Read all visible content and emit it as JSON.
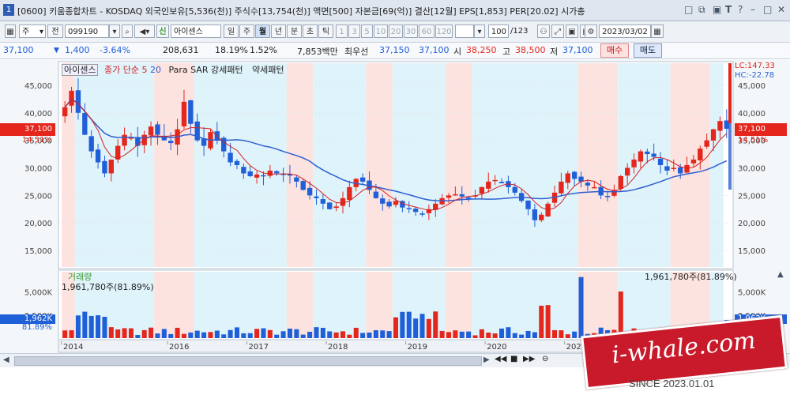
{
  "window": {
    "number": "1",
    "title": "[0600] 키움종합차트 - KOSDAQ 외국인보유[5,536(천)] 주식수[13,754(천)] 액면[500] 자본금[69(억)] 결산[12월] EPS[1,853] PER[20.02] 시가총",
    "buttons": [
      "□",
      "⧉",
      "▣",
      "T",
      "?",
      "–",
      "□",
      "✕"
    ]
  },
  "toolbar": {
    "period_select": "주",
    "prev_label": "전",
    "code": "099190",
    "tag": "신",
    "name": "아이센스",
    "period_tabs": [
      "일",
      "주",
      "월",
      "년",
      "분",
      "초",
      "틱"
    ],
    "selected_period": "월",
    "intervals": [
      "1",
      "3",
      "5",
      "10",
      "20",
      "30",
      "60",
      "120"
    ],
    "count": "100",
    "count_total": "/123",
    "date": "2023/03/02"
  },
  "quote": {
    "price": "37,100",
    "change": "1,400",
    "change_pct": "-3.64%",
    "volume": "208,631",
    "turnover_pct": "18.19%",
    "ratio": "1.52%",
    "amount": "7,853백만",
    "priority_label": "최우선",
    "bid": "37,150",
    "ask": "37,100",
    "open_label": "시",
    "open": "38,250",
    "high_label": "고",
    "high": "38,500",
    "low_label": "저",
    "low": "37,100",
    "buy_label": "매수",
    "sell_label": "매도"
  },
  "legend": {
    "name": "아이센스",
    "ma_label": "종가 단순 5",
    "ma2": "20",
    "sar": "Para SAR 강세패턴",
    "weak": "약세패턴"
  },
  "price_axis": {
    "ticks": [
      "45,000",
      "40,000",
      "35,000",
      "30,000",
      "25,000",
      "20,000",
      "15,000"
    ],
    "current_label": "37,100",
    "current_pct": "14.51%",
    "lc": "LC:147.33",
    "hc": "HC:-22.78"
  },
  "volume_panel": {
    "label": "거래량",
    "value": "1,961,780주(81.89%)",
    "value_right": "1,961,780주(81.89%)",
    "axis_ticks": [
      "5,000K",
      "2,500K"
    ],
    "current_label": "1,962K",
    "current_pct": "81.89%"
  },
  "x_axis": {
    "labels": [
      "2014",
      "2016",
      "2017",
      "2018",
      "2019",
      "2020",
      "2021"
    ]
  },
  "colors": {
    "up": "#e4261c",
    "down": "#1f5fd8",
    "ma5": "#d62020",
    "ma20": "#2e5fd0",
    "band_pink": "#fde3df",
    "band_blue": "#dff3fb"
  },
  "watermark": {
    "text": "i-whale.com",
    "since": "SINCE 2023.01.01"
  }
}
